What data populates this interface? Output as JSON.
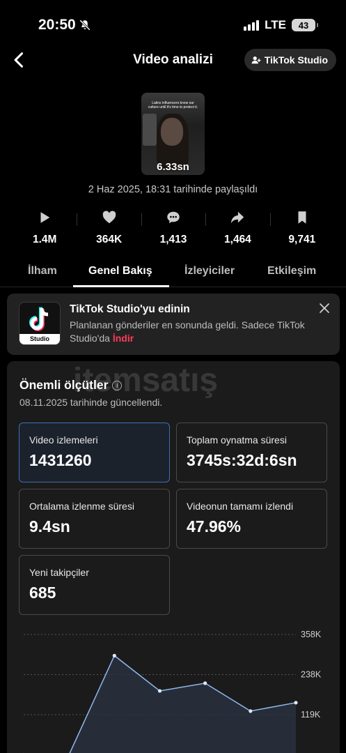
{
  "status_bar": {
    "time": "20:50",
    "network": "LTE",
    "battery": "43"
  },
  "header": {
    "title": "Video analizi",
    "studio_button": "TikTok Studio"
  },
  "video": {
    "caption": "Latinx influencers know our culture until it's time to protect it.",
    "duration": "6.33sn",
    "posted": "2 Haz 2025, 18:31 tarihinde paylaşıldı"
  },
  "stats": [
    {
      "icon": "play-icon",
      "value": "1.4M"
    },
    {
      "icon": "heart-icon",
      "value": "364K"
    },
    {
      "icon": "comment-icon",
      "value": "1,413"
    },
    {
      "icon": "share-icon",
      "value": "1,464"
    },
    {
      "icon": "bookmark-icon",
      "value": "9,741"
    }
  ],
  "tabs": [
    "İlham",
    "Genel Bakış",
    "İzleyiciler",
    "Etkileşim"
  ],
  "active_tab": "Genel Bakış",
  "promo": {
    "logo_text": "Studio",
    "title": "TikTok Studio'yu edinin",
    "desc": "Planlanan gönderiler en sonunda geldi. Sadece TikTok Studio'da",
    "link": "İndir"
  },
  "metrics": {
    "title": "Önemli ölçütler",
    "updated": "08.11.2025 tarihinde güncellendi.",
    "cards": [
      {
        "label": "Video izlemeleri",
        "value": "1431260"
      },
      {
        "label": "Toplam oynatma süresi",
        "value": "3745s:32d:6sn"
      },
      {
        "label": "Ortalama izlenme süresi",
        "value": "9.4sn"
      },
      {
        "label": "Videonun tamamı izlendi",
        "value": "47.96%"
      },
      {
        "label": "Yeni takipçiler",
        "value": "685"
      }
    ]
  },
  "watermark": "itemsatış",
  "chart_data": {
    "type": "line",
    "y_ticks": [
      "358K",
      "238K",
      "119K"
    ],
    "ylim": [
      0,
      358000
    ],
    "values": [
      0,
      0,
      295000,
      190000,
      213000,
      130000,
      155000
    ],
    "colors": {
      "line": "#8fb8f0",
      "fill": "#2a3240"
    },
    "grid": true
  },
  "colors": {
    "accent": "#ff3b5c",
    "selected_border": "#3d6fb8"
  }
}
